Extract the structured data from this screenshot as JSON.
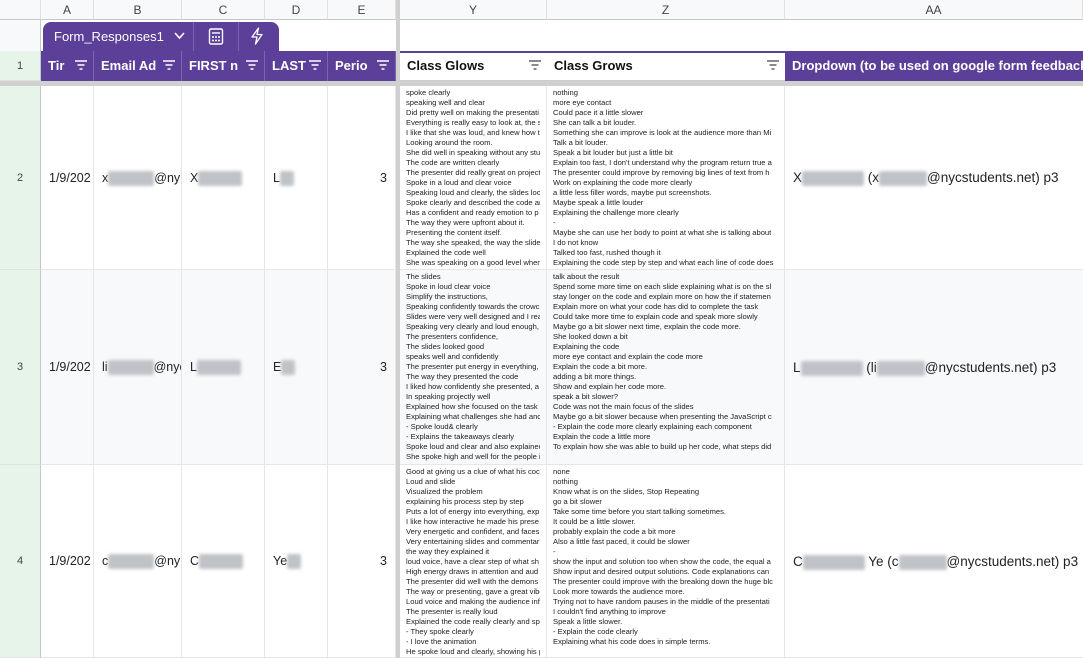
{
  "columns": {
    "A": "A",
    "B": "B",
    "C": "C",
    "D": "D",
    "E": "E",
    "Y": "Y",
    "Z": "Z",
    "AA": "AA"
  },
  "table_toolbar": {
    "name": "Form_Responses1",
    "chevron": "chevron-down-icon",
    "calc_icon": "calculator-icon",
    "bolt_icon": "lightning-icon"
  },
  "headers": {
    "time": "Timestamp",
    "email": "Email Address",
    "first": "FIRST name",
    "last": "LAST name",
    "period": "Period",
    "glows": "Class Glows",
    "grows": "Class Grows",
    "dropdown": "Dropdown (to be used on google form feedback)"
  },
  "headers_visible": {
    "time": "Tir",
    "email": "Email Ad",
    "first": "FIRST n",
    "last": "LAST",
    "period": "Perio"
  },
  "rows": [
    {
      "num": "2",
      "time": "1/9/202",
      "email_pre": "x",
      "email_post": "@ny",
      "first": "X",
      "last": "L",
      "period": "3",
      "dd_pre": "X",
      "dd_mid": "(x",
      "dd_post": "@nycstudents.net) p3",
      "glows": [
        "spoke clearly",
        "speaking well and clear",
        "Did pretty well on making the presentati",
        "Everything is really easy to look at, the s",
        "I like that she was loud, and knew how t",
        "Looking around the room.",
        "She did well in speaking without any stu",
        "The code are written clearly",
        "The presenter did really great on project",
        "Spoke in a loud and clear voice",
        "Speaking loud and clearly, the slides loo",
        "Spoke clearly and described the code ar",
        "Has a confident and ready emotion to p",
        "The way they were upfront about it.",
        "Presenting the content itself.",
        "The way she speaked, the way the slide",
        "Explained the code well",
        "She was speaking on a good level when"
      ],
      "grows": [
        "nothing",
        "more eye contact",
        "Could pace it a little slower",
        "She can talk a bit louder.",
        "Something she can improve is look at the audience more than Mi",
        "Talk a bit louder.",
        "Speak a bit louder but just a little bit",
        "Explain too fast, I don't understand why the program return true a",
        "The presenter could improve by removing big lines of text from h",
        "Work on explaining the code more clearly",
        "a little less filler words, maybe put screenshots.",
        "Maybe speak a little louder",
        "Explaining the challenge more clearly",
        "-",
        "Maybe she can use her body to point at what she is talking about",
        "I do not know",
        "Talked too fast, rushed though it",
        "Explaining the code step by step and what each line of code does"
      ]
    },
    {
      "num": "3",
      "time": "1/9/202",
      "email_pre": "li",
      "email_post": "@nycst",
      "first": "L",
      "last": "E",
      "period": "3",
      "dd_pre": "L",
      "dd_mid": "(li",
      "dd_post": "@nycstudents.net) p3",
      "glows": [
        "The slides",
        "Spoke in loud clear voice",
        "Simplify the instructions,",
        "Speaking confidently towards the crowc",
        "Slides were very well designed and I rea",
        "Speaking very clearly and loud enough,",
        "The presenters confidence,",
        "The slides looked good",
        "speaks well and confidently",
        "The presenter put energy in everything,",
        "The way they presented the code",
        "I liked how confidently she presented, a",
        "In speaking projectly well",
        "Explained how she focused on the task",
        "Explaining what challenges she had anc",
        "- Spoke loud& clearly",
        "- Explains the takeaways clearly",
        "Spoke loud and clear and also explainec",
        "She spoke high and well for the people i"
      ],
      "grows": [
        "talk about the result",
        "Spend some more time on each slide explaining what is on the sl",
        "stay longer on the code and explain more on how the if statemen",
        "Explain more on what your code has did to complete the task",
        "Could take more time to explain code and speak more slowly",
        "Maybe go a bit slower next time, explain the code more.",
        "She looked down a bit",
        "Explaining the code",
        "more eye contact and explain the code more",
        "Explain the code a bit more.",
        "adding a bit more things.",
        "Show and explain her code more.",
        "speak a bit slower?",
        "Code was not the main focus of the slides",
        "",
        "Maybe go a bit slower because when presenting the JavaScript c",
        "- Explain the code more clearly explaining each component",
        "Explain the code a little more",
        "To explain how she was able to build up her code, what steps did"
      ]
    },
    {
      "num": "4",
      "time": "1/9/202",
      "email_pre": "c",
      "email_post": "@ny",
      "first": "C",
      "last": "Ye",
      "period": "3",
      "dd_pre": "C",
      "dd_mid": "Ye (c",
      "dd_post": "@nycstudents.net) p3",
      "glows": [
        "Good at giving us a clue of what his coc",
        "Loud and slide",
        "Visualized the problem",
        "explaining his process step by step",
        "Puts a lot of energy into everything, exp",
        "I like how interactive he made his prese",
        "Very energetic and confident, and faces",
        "Very entertaining slides and commentar",
        "the way they explained it",
        "loud voice, have a clear step of what sh",
        "High energy draws in attention and aud",
        "The presenter did well with the demons",
        "The way or presenting, gave a great vibe",
        "Loud voice and making the audience inf",
        "The presenter is really loud",
        "Explained the code really clearly and sp",
        "- They spoke clearly",
        "- I love the animation",
        "He spoke loud and clearly, showing his p"
      ],
      "grows": [
        "none",
        "nothing",
        "Know what is on the slides, Stop Repeating",
        "go a bit slower",
        "Take some time before you start talking sometimes.",
        "It could be a little slower.",
        "probably explain the code a bit more",
        "Also a little fast paced, it could be slower",
        "-",
        "show the input and solution too when show the code, the equal a",
        "Show input and desired output solutions. Code explanations can",
        "The presenter could improve with the breaking down the huge blc",
        "Look more towards the audience more.",
        "Trying not to have random pauses in the middle of the presentati",
        "I couldn't find anything to improve",
        "Speak a little slower.",
        "- Explain the code clearly",
        "Explaining what his code does in simple terms."
      ]
    }
  ],
  "colors": {
    "accent": "#5b3f99",
    "row_header_bg": "#e6f4ea"
  }
}
